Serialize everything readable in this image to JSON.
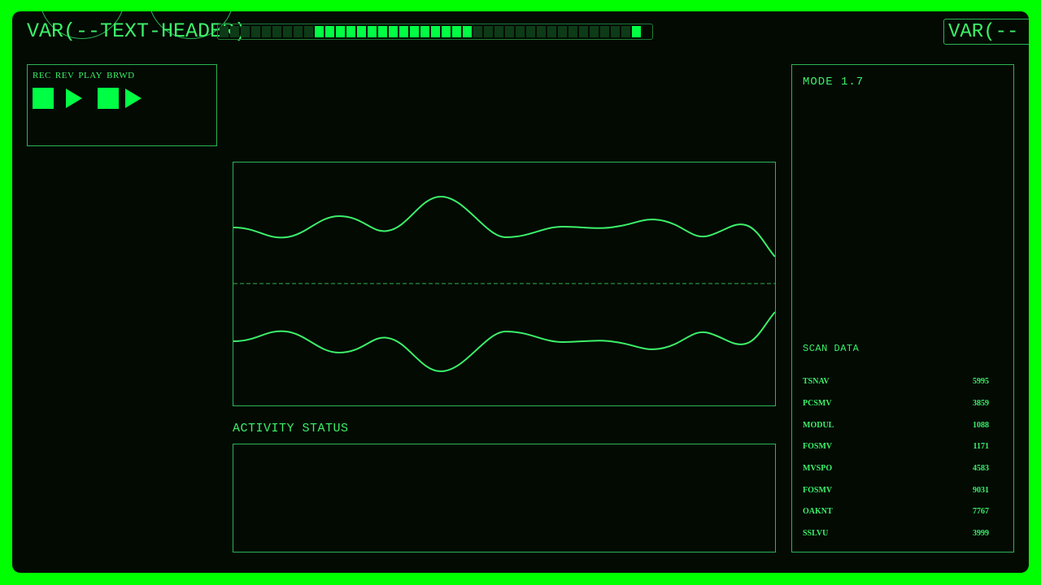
{
  "header": {
    "title": "VAR(--TEXT-HEADER)",
    "right_label": "VAR(--",
    "progress": {
      "segments_total": 40,
      "segments_on": 15,
      "segments_on_start": 9
    }
  },
  "controls": {
    "labels": [
      "REC",
      "REV",
      "PLAY",
      "BRWD"
    ],
    "buttons": [
      {
        "name": "record-button",
        "icon": "stop-square-icon"
      },
      {
        "name": "reverse-button",
        "icon": "play-triangle-icon"
      },
      {
        "name": "play-button",
        "icon": "stop-square-icon"
      },
      {
        "name": "forward-button",
        "icon": "play-triangle-icon"
      }
    ]
  },
  "mode": {
    "label": "MODE 1.7"
  },
  "scan": {
    "title": "SCAN DATA",
    "rows": [
      {
        "code": "TSNAV",
        "value": "5995"
      },
      {
        "code": "PCSMV",
        "value": "3859"
      },
      {
        "code": "MODUL",
        "value": "1088"
      },
      {
        "code": "FOSMV",
        "value": "1171"
      },
      {
        "code": "MVSPO",
        "value": "4583"
      },
      {
        "code": "FOSMV",
        "value": "9031"
      },
      {
        "code": "OAKNT",
        "value": "7767"
      },
      {
        "code": "SSLVU",
        "value": "3999"
      }
    ]
  },
  "activity": {
    "title": "ACTIVITY STATUS"
  },
  "colors": {
    "outer_bg": "#00ff00",
    "panel_bg": "#020a02",
    "accent": "#3cf06a",
    "bright": "#00ff44",
    "border": "#2bb552",
    "segment_off": "#0d3b17"
  }
}
